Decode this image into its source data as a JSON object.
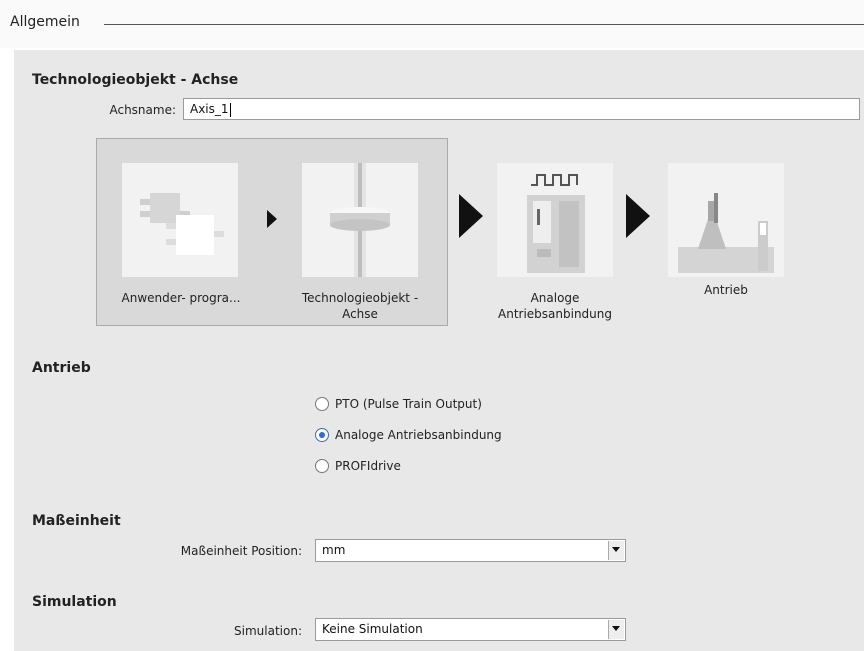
{
  "header": {
    "title": "Allgemein"
  },
  "tech_object": {
    "section_title": "Technologieobjekt - Achse",
    "axis_name_label": "Achsname:",
    "axis_name_value": "Axis_1"
  },
  "flow": {
    "steps": [
      {
        "label_line1": "Anwender- progra...",
        "label_line2": ""
      },
      {
        "label_line1": "Technologieobjekt -",
        "label_line2": "Achse"
      },
      {
        "label_line1": "Analoge",
        "label_line2": "Antriebsanbindung"
      },
      {
        "label_line1": "Antrieb",
        "label_line2": ""
      }
    ]
  },
  "drive": {
    "section_title": "Antrieb",
    "options": [
      {
        "label": "PTO (Pulse Train Output)",
        "checked": false
      },
      {
        "label": "Analoge Antriebsanbindung",
        "checked": true
      },
      {
        "label": "PROFIdrive",
        "checked": false
      }
    ]
  },
  "unit": {
    "section_title": "Maßeinheit",
    "position_label": "Maßeinheit Position:",
    "position_value": "mm"
  },
  "simulation": {
    "section_title": "Simulation",
    "label": "Simulation:",
    "value": "Keine Simulation"
  }
}
